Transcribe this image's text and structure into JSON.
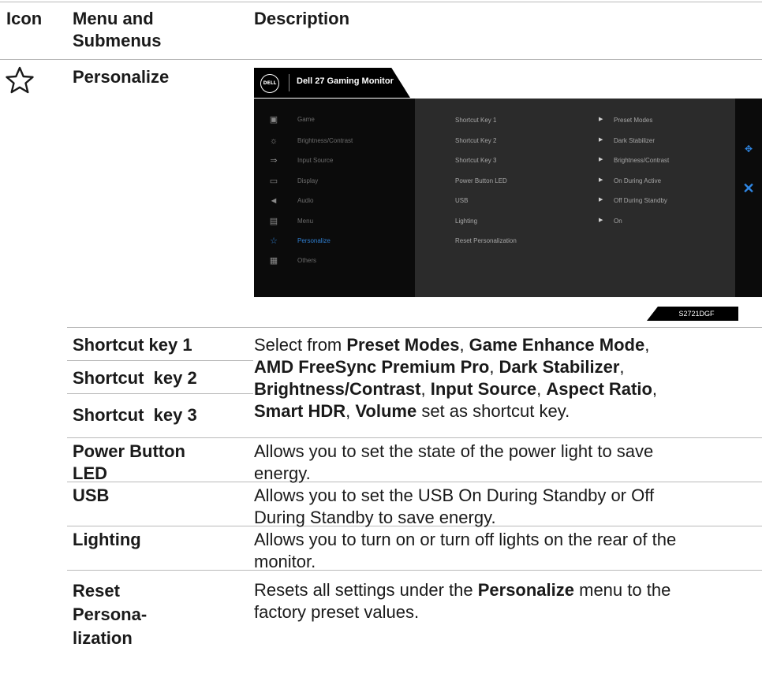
{
  "header": {
    "col_icon": "Icon",
    "col_menu_line1": "Menu and",
    "col_menu_line2": "Submenus",
    "col_desc": "Description"
  },
  "section": {
    "title": "Personalize",
    "icon": "star-outline-icon"
  },
  "osd": {
    "logo": "DELL",
    "title": "Dell 27 Gaming Monitor",
    "menu_items": [
      {
        "label": "Game",
        "icon": "game-icon"
      },
      {
        "label": "Brightness/Contrast",
        "icon": "brightness-icon"
      },
      {
        "label": "Input Source",
        "icon": "input-source-icon"
      },
      {
        "label": "Display",
        "icon": "display-icon"
      },
      {
        "label": "Audio",
        "icon": "audio-icon"
      },
      {
        "label": "Menu",
        "icon": "menu-icon"
      },
      {
        "label": "Personalize",
        "icon": "star-icon",
        "active": true
      },
      {
        "label": "Others",
        "icon": "others-icon"
      }
    ],
    "settings": [
      {
        "label": "Shortcut Key 1",
        "value": "Preset Modes"
      },
      {
        "label": "Shortcut Key 2",
        "value": "Dark Stabilizer"
      },
      {
        "label": "Shortcut Key 3",
        "value": "Brightness/Contrast"
      },
      {
        "label": "Power Button LED",
        "value": "On During Active"
      },
      {
        "label": "USB",
        "value": "Off During Standby"
      },
      {
        "label": "Lighting",
        "value": "On"
      },
      {
        "label": "Reset Personalization",
        "value": ""
      }
    ],
    "model": "S2721DGF",
    "accent_color": "#2f86e3"
  },
  "rows": {
    "shortcut1": "Shortcut key 1",
    "shortcut2": "Shortcut  key 2",
    "shortcut3": "Shortcut  key 3",
    "shortcut_desc": {
      "t1": "Select from ",
      "b1": "Preset Modes",
      "t2": ", ",
      "b2": "Game Enhance Mode",
      "t3": ",",
      "b3": "AMD FreeSync Premium Pro",
      "t4": ", ",
      "b4": "Dark Stabilizer",
      "t5": ",",
      "b5": "Brightness/Contrast",
      "t6": ", ",
      "b6": "Input Source",
      "t7": ", ",
      "b7": "Aspect Ratio",
      "t8": ",",
      "b8": "Smart HDR",
      "t9": ", ",
      "b9": "Volume",
      "t10": " set as shortcut key."
    },
    "power_led_1": "Power Button",
    "power_led_2": "LED",
    "power_led_desc_1": "Allows you to set the state of the power light to save",
    "power_led_desc_2": "energy.",
    "usb": "USB",
    "usb_desc_1": "Allows you to set the USB On During Standby or Off",
    "usb_desc_2": "During Standby to save energy.",
    "lighting": "Lighting",
    "lighting_desc_1": "Allows you to turn on or turn off lights on the rear of the",
    "lighting_desc_2": "monitor.",
    "reset_1": "Reset",
    "reset_2": "Persona-",
    "reset_3": "lization",
    "reset_desc_t1": "Resets all settings under the ",
    "reset_desc_b1": "Personalize",
    "reset_desc_t2": " menu to the",
    "reset_desc_2": "factory preset values."
  }
}
